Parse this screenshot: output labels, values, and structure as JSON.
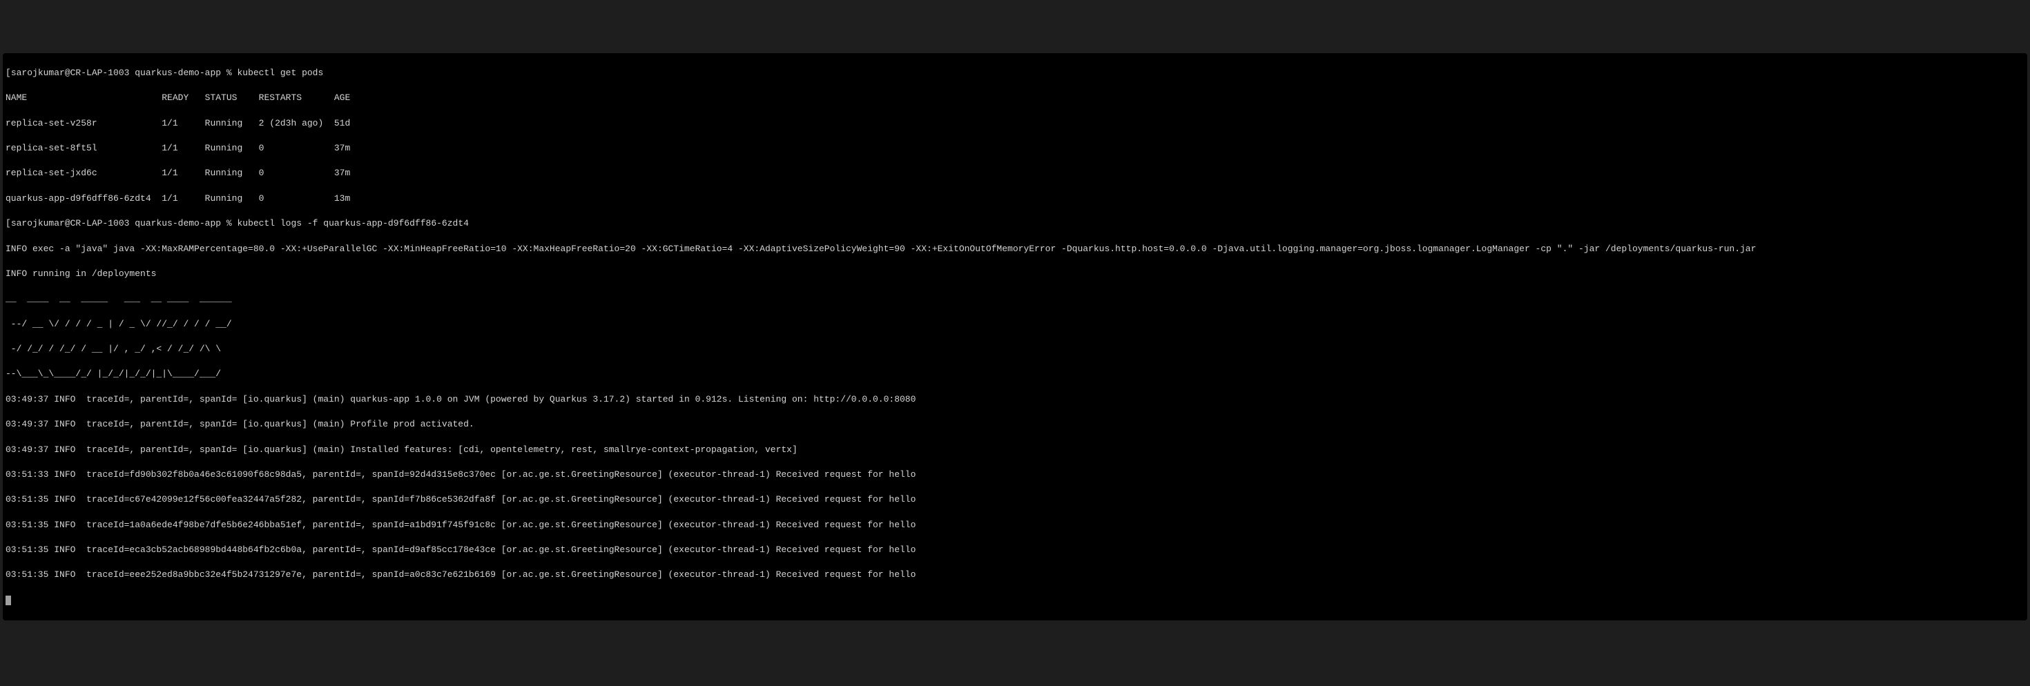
{
  "prompt1": {
    "bracket_open": "[",
    "user_host_path": "sarojkumar@CR-LAP-1003 quarkus-demo-app",
    "percent": " % ",
    "command": "kubectl get pods"
  },
  "pods_header": "NAME                         READY   STATUS    RESTARTS      AGE",
  "pods": [
    "replica-set-v258r            1/1     Running   2 (2d3h ago)  51d",
    "replica-set-8ft5l            1/1     Running   0             37m",
    "replica-set-jxd6c            1/1     Running   0             37m",
    "quarkus-app-d9f6dff86-6zdt4  1/1     Running   0             13m"
  ],
  "prompt2": {
    "bracket_open": "[",
    "user_host_path": "sarojkumar@CR-LAP-1003 quarkus-demo-app",
    "percent": " % ",
    "command": "kubectl logs -f quarkus-app-d9f6dff86-6zdt4"
  },
  "logs": [
    "INFO exec -a \"java\" java -XX:MaxRAMPercentage=80.0 -XX:+UseParallelGC -XX:MinHeapFreeRatio=10 -XX:MaxHeapFreeRatio=20 -XX:GCTimeRatio=4 -XX:AdaptiveSizePolicyWeight=90 -XX:+ExitOnOutOfMemoryError -Dquarkus.http.host=0.0.0.0 -Djava.util.logging.manager=org.jboss.logmanager.LogManager -cp \".\" -jar /deployments/quarkus-run.jar",
    "INFO running in /deployments",
    "__  ____  __  _____   ___  __ ____  ______",
    " --/ __ \\/ / / / _ | / _ \\/ //_/ / / / __/",
    " -/ /_/ / /_/ / __ |/ , _/ ,< / /_/ /\\ \\",
    "--\\___\\_\\____/_/ |_/_/|_/_/|_|\\____/___/",
    "03:49:37 INFO  traceId=, parentId=, spanId= [io.quarkus] (main) quarkus-app 1.0.0 on JVM (powered by Quarkus 3.17.2) started in 0.912s. Listening on: http://0.0.0.0:8080",
    "03:49:37 INFO  traceId=, parentId=, spanId= [io.quarkus] (main) Profile prod activated.",
    "03:49:37 INFO  traceId=, parentId=, spanId= [io.quarkus] (main) Installed features: [cdi, opentelemetry, rest, smallrye-context-propagation, vertx]",
    "03:51:33 INFO  traceId=fd90b302f8b0a46e3c61090f68c98da5, parentId=, spanId=92d4d315e8c370ec [or.ac.ge.st.GreetingResource] (executor-thread-1) Received request for hello",
    "03:51:35 INFO  traceId=c67e42099e12f56c00fea32447a5f282, parentId=, spanId=f7b86ce5362dfa8f [or.ac.ge.st.GreetingResource] (executor-thread-1) Received request for hello",
    "03:51:35 INFO  traceId=1a0a6ede4f98be7dfe5b6e246bba51ef, parentId=, spanId=a1bd91f745f91c8c [or.ac.ge.st.GreetingResource] (executor-thread-1) Received request for hello",
    "03:51:35 INFO  traceId=eca3cb52acb68989bd448b64fb2c6b0a, parentId=, spanId=d9af85cc178e43ce [or.ac.ge.st.GreetingResource] (executor-thread-1) Received request for hello",
    "03:51:35 INFO  traceId=eee252ed8a9bbc32e4f5b24731297e7e, parentId=, spanId=a0c83c7e621b6169 [or.ac.ge.st.GreetingResource] (executor-thread-1) Received request for hello"
  ]
}
